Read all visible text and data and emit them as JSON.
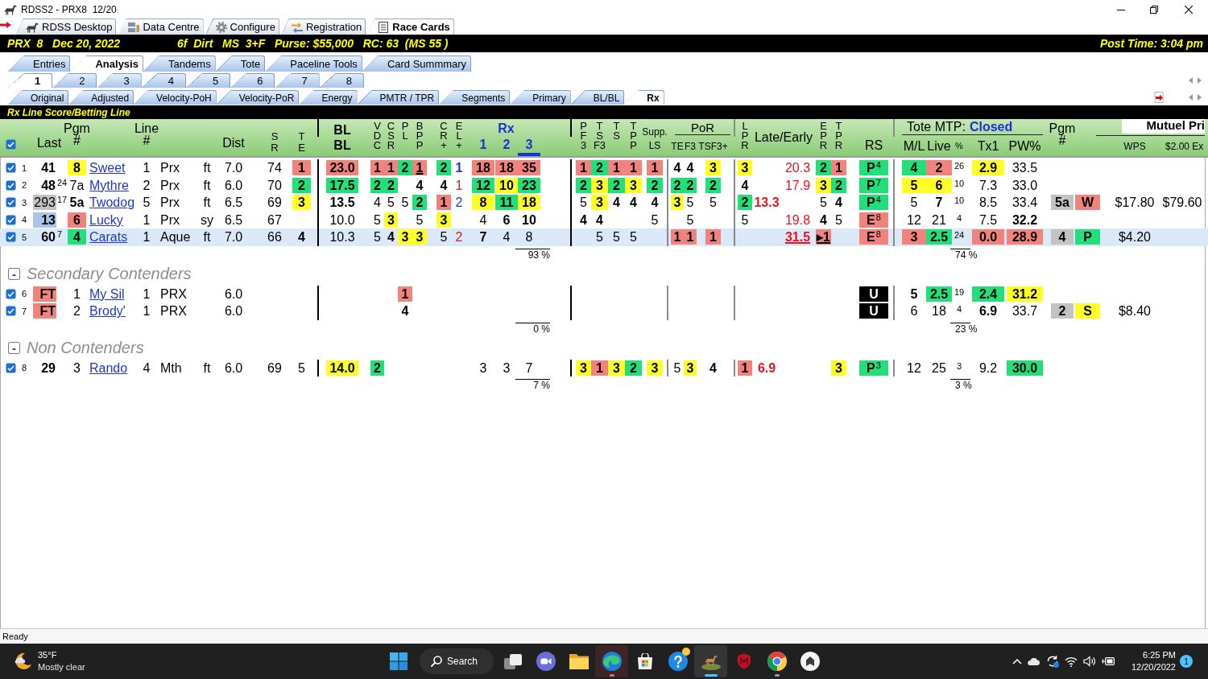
{
  "window": {
    "title": "RDSS2 - PRX8  12/20"
  },
  "app_tabs": [
    {
      "label": "RDSS Desktop",
      "selected": false
    },
    {
      "label": "Data Centre",
      "selected": false
    },
    {
      "label": "Configure",
      "selected": false
    },
    {
      "label": "Registration",
      "selected": false
    },
    {
      "label": "Race Cards",
      "selected": true
    }
  ],
  "race_bar": {
    "race": "PRX  8   Dec 20, 2022",
    "conditions": "6f  Dirt   MS  3+F   Purse: $55,000   RC: 63  (MS 55 )",
    "post_time": "Post Time: 3:04 pm"
  },
  "view_tabs": [
    {
      "label": "Entries",
      "selected": false
    },
    {
      "label": "Analysis",
      "selected": true
    },
    {
      "label": "Tandems",
      "selected": false
    },
    {
      "label": "Tote",
      "selected": false
    },
    {
      "label": "Paceline Tools",
      "selected": false
    },
    {
      "label": "Card Summmary",
      "selected": false
    }
  ],
  "race_tabs": [
    {
      "label": "1",
      "selected": true
    },
    {
      "label": "2",
      "selected": false
    },
    {
      "label": "3",
      "selected": false
    },
    {
      "label": "4",
      "selected": false
    },
    {
      "label": "5",
      "selected": false
    },
    {
      "label": "6",
      "selected": false
    },
    {
      "label": "7",
      "selected": false
    },
    {
      "label": "8",
      "selected": false
    }
  ],
  "sub_tabs": [
    {
      "label": "Original",
      "selected": false
    },
    {
      "label": "Adjusted",
      "selected": false
    },
    {
      "label": "Velocity-PoH",
      "selected": false
    },
    {
      "label": "Velocity-PoR",
      "selected": false
    },
    {
      "label": "Energy",
      "selected": false
    },
    {
      "label": "PMTR / TPR",
      "selected": false
    },
    {
      "label": "Segments",
      "selected": false
    },
    {
      "label": "Primary",
      "selected": false
    },
    {
      "label": "BL/BL",
      "selected": false
    },
    {
      "label": "Rx",
      "selected": true
    }
  ],
  "panel": {
    "title": "Rx Line Score/Betting Line"
  },
  "table": {
    "select_all": {
      "checked": true
    },
    "columns": [
      {
        "label": "Last"
      },
      {
        "label": "Pgm #"
      },
      {
        "label": "Line #"
      },
      {
        "label": "Dist"
      },
      {
        "label": "S R"
      },
      {
        "label": "T E"
      },
      {
        "label": "BL BL"
      },
      {
        "label": "V D C"
      },
      {
        "label": "C S R"
      },
      {
        "label": "P L"
      },
      {
        "label": "B P P"
      },
      {
        "label": "C R +"
      },
      {
        "label": "E L +"
      },
      {
        "label": "Rx",
        "columns": [
          {
            "label": "1",
            "selected": false
          },
          {
            "label": "2",
            "selected": false
          },
          {
            "label": "3",
            "selected": true
          }
        ]
      },
      {
        "label": "P F 3"
      },
      {
        "label": "T S F3"
      },
      {
        "label": "T S"
      },
      {
        "label": "T P P"
      },
      {
        "label": "Supp. LS"
      },
      {
        "label": "PoR",
        "columns": [
          {
            "label": "TE"
          },
          {
            "label": "F3"
          },
          {
            "label": "TSF3+"
          }
        ]
      },
      {
        "label": "L P R"
      },
      {
        "label": "Late/Early"
      },
      {
        "label": "E P R"
      },
      {
        "label": "T P R"
      },
      {
        "label": "RS"
      },
      {
        "label": "Tote MTP:",
        "status": "Closed",
        "columns": [
          {
            "label": "M/L"
          },
          {
            "label": "Live"
          },
          {
            "label": "%"
          },
          {
            "label": "Tx1"
          },
          {
            "label": "PW%"
          }
        ]
      },
      {
        "label": "Pgm #"
      },
      {
        "label": "Mutuel Pri",
        "columns": [
          {
            "label": "WPS"
          },
          {
            "label": "$2.00 Ex"
          }
        ]
      }
    ],
    "sections": [
      {
        "rows": [
          {
            "number": "1",
            "checked": true,
            "selected": false,
            "cells": [
              {
                "text": "41",
                "bold": true
              },
              {
                "text": "8",
                "bold": true,
                "color": "#ffff26"
              },
              "Sweet",
              "1",
              "Prx",
              "ft",
              "7.0",
              "74",
              {
                "text": "1",
                "bold": true,
                "color": "#f2837c"
              },
              {
                "text": "23.0",
                "bold": true,
                "color": "#f2837c"
              },
              {
                "text": "1",
                "bold": true,
                "color": "#f2837c"
              },
              {
                "text": "1",
                "bold": true,
                "color": "#f2837c"
              },
              {
                "text": "2",
                "bold": true,
                "color": "#21e07a"
              },
              {
                "text": "1",
                "bold": true,
                "color": "#f2837c",
                "underlined": true
              },
              {
                "text": "2",
                "bold": true,
                "color": "#21e07a"
              },
              {
                "text": "1",
                "bold": true,
                "ink": {
                  "color": "#1f33d6"
                }
              },
              {
                "text": "18",
                "bold": true,
                "color": "#f2837c"
              },
              {
                "text": "18",
                "bold": true,
                "color": "#f2837c"
              },
              {
                "text": "35",
                "bold": true,
                "color": "#f2837c"
              },
              {
                "text": "1",
                "bold": true,
                "color": "#f2837c"
              },
              {
                "text": "2",
                "bold": true,
                "color": "#21e07a"
              },
              {
                "text": "1",
                "bold": true,
                "color": "#f2837c"
              },
              {
                "text": "1",
                "bold": true,
                "color": "#f2837c"
              },
              {
                "text": "1",
                "bold": true,
                "color": "#f2837c"
              },
              {
                "text": "4",
                "bold": true
              },
              {
                "text": "4",
                "bold": true
              },
              {
                "text": "3",
                "bold": true,
                "color": "#ffff26"
              },
              {
                "text": "3",
                "bold": true,
                "color": "#ffff26"
              },
              null,
              {
                "text": "20.3",
                "ink": {
                  "color": "#e8141c"
                }
              },
              {
                "text": "2",
                "bold": true,
                "color": "#21e07a"
              },
              {
                "text": "1",
                "bold": true,
                "color": "#f2837c"
              },
              {
                "text": "P$^{4}$",
                "bold": true,
                "color": "#21e07a"
              },
              {
                "text": "4",
                "bold": true,
                "color": "#21e07a"
              },
              {
                "text": "2",
                "bold": true,
                "color": "#f2837c"
              },
              "26",
              {
                "text": "2.9",
                "bold": true,
                "color": "#ffff26"
              },
              "33.5",
              null,
              null,
              null,
              null
            ]
          },
          {
            "number": "2",
            "checked": true,
            "selected": false,
            "cells": [
              {
                "text": "48",
                "sup": "24",
                "bold": true
              },
              "7a",
              "Mythre",
              "2",
              "Prx",
              "ft",
              "6.0",
              "70",
              {
                "text": "2",
                "bold": true,
                "color": "#21e07a"
              },
              {
                "text": "17.5",
                "bold": true,
                "color": "#21e07a"
              },
              {
                "text": "2",
                "bold": true,
                "color": "#21e07a"
              },
              {
                "text": "2",
                "bold": true,
                "color": "#21e07a"
              },
              null,
              {
                "text": "4",
                "bold": true
              },
              {
                "text": "4",
                "bold": true
              },
              {
                "text": "1",
                "ink": {
                  "color": "#c0262c"
                }
              },
              {
                "text": "12",
                "bold": true,
                "color": "#21e07a"
              },
              {
                "text": "10",
                "bold": true,
                "color": "#ffff26"
              },
              {
                "text": "23",
                "bold": true,
                "color": "#21e07a"
              },
              {
                "text": "2",
                "bold": true,
                "color": "#21e07a"
              },
              {
                "text": "3",
                "bold": true,
                "color": "#ffff26"
              },
              {
                "text": "2",
                "bold": true,
                "color": "#21e07a"
              },
              {
                "text": "3",
                "bold": true,
                "color": "#ffff26"
              },
              {
                "text": "2",
                "bold": true,
                "color": "#21e07a"
              },
              {
                "text": "2",
                "bold": true,
                "color": "#21e07a"
              },
              {
                "text": "2",
                "bold": true,
                "color": "#21e07a"
              },
              {
                "text": "2",
                "bold": true,
                "color": "#21e07a"
              },
              {
                "text": "4",
                "bold": true
              },
              null,
              {
                "text": "17.9",
                "ink": {
                  "color": "#e8141c"
                }
              },
              {
                "text": "3",
                "bold": true,
                "color": "#ffff26"
              },
              {
                "text": "2",
                "bold": true,
                "color": "#21e07a"
              },
              {
                "text": "P$^{7}$",
                "bold": true,
                "color": "#21e07a"
              },
              {
                "text": "5",
                "bold": true,
                "color": "#ffff26"
              },
              {
                "text": "6",
                "bold": true,
                "color": "#ffff26"
              },
              "10",
              "7.3",
              "33.0",
              null,
              null,
              null,
              null
            ]
          },
          {
            "number": "3",
            "checked": true,
            "selected": false,
            "cells": [
              {
                "text": "293",
                "sup": "17",
                "color": "#c3c3c3"
              },
              {
                "text": "5a",
                "bold": true
              },
              "Twodog",
              "5",
              "Prx",
              "ft",
              "6.5",
              "69",
              {
                "text": "3",
                "bold": true,
                "color": "#ffff26"
              },
              {
                "text": "13.5",
                "bold": true
              },
              "4",
              "5",
              "5",
              {
                "text": "2",
                "bold": true,
                "color": "#21e07a"
              },
              {
                "text": "1",
                "bold": true,
                "color": "#f2837c"
              },
              {
                "text": "2",
                "ink": {
                  "color": "#1f33d6"
                }
              },
              {
                "text": "8",
                "bold": true,
                "color": "#ffff26"
              },
              {
                "text": "11",
                "bold": true,
                "color": "#21e07a"
              },
              {
                "text": "18",
                "bold": true,
                "color": "#ffff26"
              },
              "5",
              {
                "text": "3",
                "bold": true,
                "color": "#ffff26"
              },
              {
                "text": "4",
                "bold": true
              },
              {
                "text": "4",
                "bold": true
              },
              {
                "text": "4",
                "bold": true
              },
              {
                "text": "3",
                "bold": true,
                "color": "#ffff26"
              },
              "5",
              "5",
              {
                "text": "2",
                "bold": true,
                "color": "#21e07a"
              },
              {
                "text": "13.3",
                "bold": true,
                "ink": {
                  "color": "#e8141c"
                }
              },
              null,
              "5",
              {
                "text": "4",
                "bold": true
              },
              {
                "text": "P$^{4}$",
                "bold": true,
                "color": "#21e07a"
              },
              "5",
              {
                "text": "7",
                "bold": true
              },
              "10",
              "8.5",
              "33.4",
              {
                "text": "5a",
                "bold": true,
                "color": "#c3c3c3"
              },
              {
                "text": "W",
                "bold": true,
                "color": "#f2837c"
              },
              "$17.80",
              "$79.60"
            ]
          },
          {
            "number": "4",
            "checked": true,
            "selected": false,
            "cells": [
              {
                "text": "13",
                "bold": true,
                "color": "#a9c6e8"
              },
              {
                "text": "6",
                "bold": true,
                "color": "#f2837c"
              },
              "Lucky",
              "1",
              "Prx",
              "sy",
              "6.5",
              "67",
              null,
              "10.0",
              "5",
              {
                "text": "3",
                "bold": true,
                "color": "#ffff26"
              },
              null,
              "5",
              {
                "text": "3",
                "bold": true,
                "color": "#ffff26"
              },
              null,
              "4",
              {
                "text": "6",
                "bold": true
              },
              {
                "text": "10",
                "bold": true
              },
              {
                "text": "4",
                "bold": true
              },
              {
                "text": "4",
                "bold": true
              },
              null,
              null,
              "5",
              null,
              "5",
              null,
              "5",
              null,
              {
                "text": "19.8",
                "ink": {
                  "color": "#e8141c"
                }
              },
              {
                "text": "4",
                "bold": true
              },
              "5",
              {
                "text": "E$^{8}$",
                "bold": true,
                "color": "#f2837c"
              },
              "12",
              "21",
              "4",
              "7.5",
              {
                "text": "32.2",
                "bold": true
              },
              null,
              null,
              null,
              null
            ]
          },
          {
            "number": "5",
            "checked": true,
            "selected": true,
            "cells": [
              {
                "text": "60",
                "sup": "7",
                "bold": true
              },
              {
                "text": "4",
                "bold": true,
                "color": "#21e07a"
              },
              "Carats",
              "1",
              "Aque",
              "ft",
              "7.0",
              "66",
              {
                "text": "4",
                "bold": true
              },
              "10.3",
              "5",
              {
                "text": "4",
                "bold": true
              },
              {
                "text": "3",
                "bold": true,
                "color": "#ffff26"
              },
              {
                "text": "3",
                "bold": true,
                "color": "#ffff26"
              },
              "5",
              {
                "text": "2",
                "ink": {
                  "color": "#c0262c"
                }
              },
              {
                "text": "7",
                "bold": true
              },
              "4",
              "8",
              null,
              "5",
              "5",
              "5",
              null,
              {
                "text": "1",
                "bold": true,
                "color": "#f2837c"
              },
              {
                "text": "1",
                "bold": true,
                "color": "#f2837c"
              },
              {
                "text": "1",
                "bold": true,
                "color": "#f2837c"
              },
              null,
              null,
              {
                "text": "31.5",
                "bold": true,
                "ink": {
                  "color": "#e8141c"
                },
                "underlined": true
              },
              {
                "text": "▸1",
                "bold": true,
                "color": "#f2837c",
                "underlined": true
              },
              null,
              {
                "text": "E$^{8}$",
                "bold": true,
                "color": "#f2837c"
              },
              {
                "text": "3",
                "bold": true,
                "color": "#f2837c"
              },
              {
                "text": "2.5",
                "bold": true,
                "color": "#21e07a"
              },
              "24",
              {
                "text": "0.0",
                "bold": true,
                "color": "#f2837c"
              },
              {
                "text": "28.9",
                "bold": true,
                "color": "#f2837c"
              },
              {
                "text": "4",
                "bold": true,
                "color": "#c3c3c3"
              },
              {
                "text": "P",
                "bold": true,
                "color": "#21e07a"
              },
              "$4.20",
              null
            ]
          }
        ],
        "totals": [
          "93 %",
          "74 %"
        ]
      },
      {
        "toggle": "-",
        "title": "Secondary Contenders",
        "rows": [
          {
            "number": "6",
            "checked": true,
            "selected": false,
            "cells": [
              {
                "text": "FT",
                "bold": true,
                "color": "#f2837c"
              },
              "1",
              "My Sil",
              "1",
              "PRX",
              null,
              "6.0",
              null,
              null,
              null,
              null,
              null,
              {
                "text": "1",
                "bold": true,
                "color": "#f2837c"
              },
              null,
              null,
              null,
              null,
              null,
              null,
              null,
              null,
              null,
              null,
              null,
              null,
              null,
              null,
              null,
              null,
              null,
              null,
              null,
              {
                "text": "U",
                "bold": true,
                "color": "#000000"
              },
              {
                "text": "5",
                "bold": true
              },
              {
                "text": "2.5",
                "bold": true,
                "color": "#21e07a"
              },
              "19",
              {
                "text": "2.4",
                "bold": true,
                "color": "#21e07a"
              },
              {
                "text": "31.2",
                "bold": true,
                "color": "#ffff26"
              },
              null,
              null,
              null,
              null
            ]
          },
          {
            "number": "7",
            "checked": true,
            "selected": false,
            "cells": [
              {
                "text": "FT",
                "bold": true,
                "color": "#f2837c"
              },
              "2",
              "Brody'",
              "1",
              "PRX",
              null,
              "6.0",
              null,
              null,
              null,
              null,
              null,
              {
                "text": "4",
                "bold": true
              },
              null,
              null,
              null,
              null,
              null,
              null,
              null,
              null,
              null,
              null,
              null,
              null,
              null,
              null,
              null,
              null,
              null,
              null,
              null,
              {
                "text": "U",
                "bold": true,
                "color": "#000000"
              },
              "6",
              "18",
              "4",
              {
                "text": "6.9",
                "bold": true
              },
              "33.7",
              {
                "text": "2",
                "bold": true,
                "color": "#c3c3c3"
              },
              {
                "text": "S",
                "bold": true,
                "color": "#ffff26"
              },
              "$8.40",
              null
            ]
          }
        ],
        "totals": [
          "0 %",
          "23 %"
        ]
      },
      {
        "toggle": "-",
        "title": "Non Contenders",
        "rows": [
          {
            "number": "8",
            "checked": true,
            "selected": false,
            "cells": [
              {
                "text": "29",
                "bold": true
              },
              "3",
              "Rando",
              "4",
              "Mth",
              "ft",
              "6.0",
              "69",
              "5",
              {
                "text": "14.0",
                "bold": true,
                "color": "#ffff26"
              },
              {
                "text": "2",
                "bold": true,
                "color": "#21e07a"
              },
              null,
              null,
              null,
              null,
              null,
              "3",
              "3",
              "7",
              {
                "text": "3",
                "bold": true,
                "color": "#ffff26"
              },
              {
                "text": "1",
                "bold": true,
                "color": "#f2837c"
              },
              {
                "text": "3",
                "bold": true,
                "color": "#ffff26"
              },
              {
                "text": "2",
                "bold": true,
                "color": "#21e07a"
              },
              {
                "text": "3",
                "bold": true,
                "color": "#ffff26"
              },
              "5",
              {
                "text": "3",
                "bold": true,
                "color": "#ffff26"
              },
              {
                "text": "4",
                "bold": true
              },
              {
                "text": "1",
                "bold": true,
                "color": "#f2837c"
              },
              {
                "text": "6.9",
                "bold": true,
                "ink": {
                  "color": "#e8141c"
                }
              },
              null,
              null,
              {
                "text": "3",
                "bold": true,
                "color": "#ffff26"
              },
              {
                "text": "P$^{3}$",
                "bold": true,
                "color": "#21e07a"
              },
              "12",
              "25",
              "3",
              "9.2",
              {
                "text": "30.0",
                "bold": true,
                "color": "#21e07a"
              },
              null,
              null,
              null,
              null
            ]
          }
        ],
        "totals": [
          "7 %",
          "3 %"
        ]
      }
    ]
  },
  "status_bar": {
    "text": "Ready"
  },
  "taskbar": {
    "weather": {
      "temperature": "35°F",
      "condition": "Mostly clear"
    },
    "search": {
      "label": "Search"
    },
    "apps": [
      {
        "kind": "start",
        "running": false,
        "active": false,
        "attention": false
      },
      {
        "kind": "task-view",
        "running": false,
        "active": false,
        "attention": false
      },
      {
        "kind": "chat",
        "running": false,
        "active": false,
        "attention": false
      },
      {
        "kind": "folder",
        "running": false,
        "active": false,
        "attention": false
      },
      {
        "kind": "swirl-browser",
        "running": true,
        "active": false,
        "attention": true
      },
      {
        "kind": "store",
        "running": false,
        "active": false,
        "attention": false
      },
      {
        "kind": "help",
        "running": false,
        "active": false,
        "attention": false,
        "badge": true
      },
      {
        "kind": "horse",
        "running": true,
        "active": true,
        "attention": false
      },
      {
        "kind": "shield",
        "running": false,
        "active": false,
        "attention": false
      },
      {
        "kind": "ring-browser",
        "running": true,
        "active": false,
        "attention": false
      },
      {
        "kind": "house",
        "running": false,
        "active": false,
        "attention": false
      }
    ],
    "tray": {
      "time": "6:25 PM",
      "date": "12/20/2022",
      "notifications": "1"
    }
  }
}
